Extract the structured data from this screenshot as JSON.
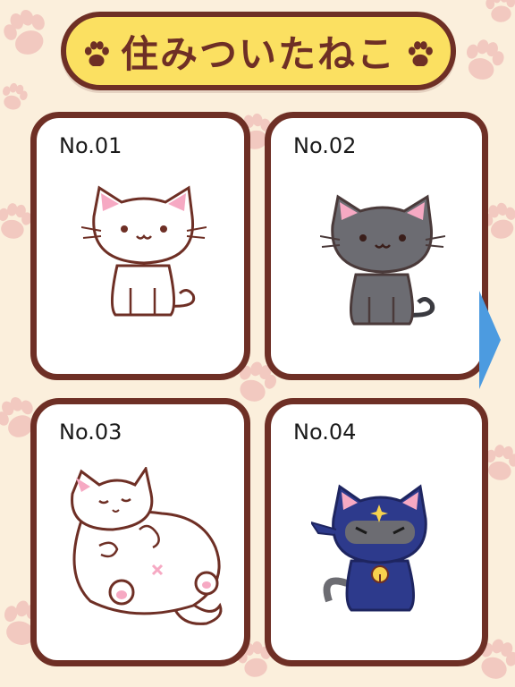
{
  "header": {
    "title": "住みついたねこ",
    "left_icon": "paw-icon",
    "right_icon": "paw-icon"
  },
  "cards": [
    {
      "number": "No.01",
      "cat": "white-cat-sitting"
    },
    {
      "number": "No.02",
      "cat": "gray-cat-sitting"
    },
    {
      "number": "No.03",
      "cat": "chubby-white-cat-lying"
    },
    {
      "number": "No.04",
      "cat": "ninja-cat"
    }
  ],
  "nav": {
    "next_icon": "arrow-right-icon"
  },
  "colors": {
    "background": "#fbefdc",
    "paw_pattern": "#f2c9c0",
    "border": "#6e2f25",
    "banner": "#fbe061",
    "card": "#ffffff",
    "arrow": "#4c9be0",
    "ear_pink": "#f6a9c3",
    "gray_cat": "#6c6c72",
    "ninja_blue": "#2d3a8c"
  }
}
